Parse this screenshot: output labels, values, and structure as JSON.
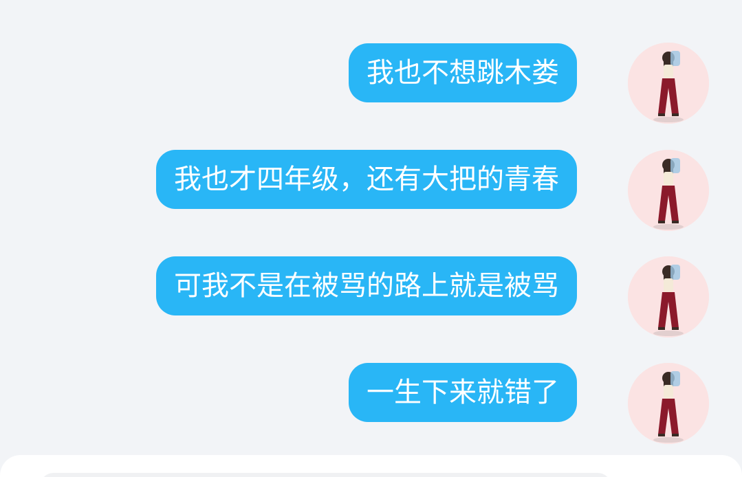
{
  "messages": [
    {
      "text": "我也不想跳木娄"
    },
    {
      "text": "我也才四年级，还有大把的青春"
    },
    {
      "text": "可我不是在被骂的路上就是被骂"
    },
    {
      "text": "一生下来就错了"
    }
  ],
  "colors": {
    "background": "#f2f4f7",
    "bubble": "#29b6f6",
    "bubble_text": "#ffffff",
    "avatar_bg": "#fbe3e3"
  },
  "icons": {
    "avatar": "avatar-girl-red-pants"
  }
}
